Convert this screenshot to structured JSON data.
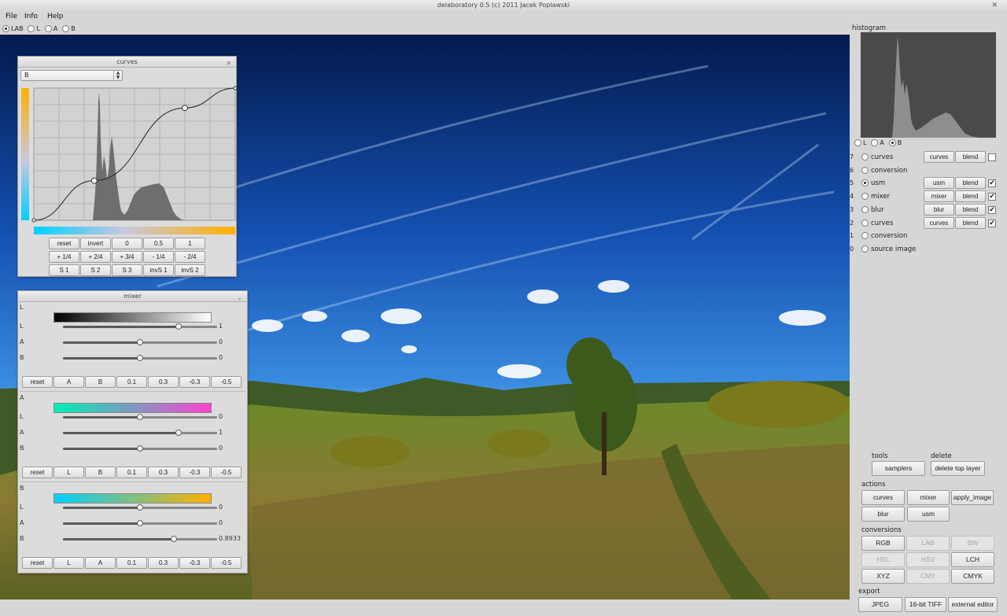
{
  "window": {
    "title": "delaboratory 0.5 (c) 2011 Jacek Poplawski",
    "close": "✕"
  },
  "menu": [
    "File",
    "Info",
    "Help"
  ],
  "modes": {
    "items": [
      "LAB",
      "L",
      "A",
      "B"
    ],
    "selected": 0
  },
  "curves": {
    "title": "curves",
    "close": "✕",
    "channel": "B",
    "curve_points": [
      [
        0,
        0
      ],
      [
        0.3,
        0.3
      ],
      [
        0.75,
        0.85
      ],
      [
        1,
        1
      ]
    ],
    "buttons_row1": [
      "reset",
      "invert",
      "0",
      "0.5",
      "1"
    ],
    "buttons_row2": [
      "+ 1/4",
      "+ 2/4",
      "+ 3/4",
      "- 1/4",
      "- 2/4"
    ],
    "buttons_row3": [
      "S 1",
      "S 2",
      "S 3",
      "invS 1",
      "invS 2"
    ]
  },
  "mixer": {
    "title": "mixer",
    "close": "⌄",
    "sections": [
      {
        "label": "L",
        "gradient": [
          "#000000",
          "#ffffff"
        ],
        "rows": [
          {
            "label": "L",
            "value": "1",
            "pos": 0.75
          },
          {
            "label": "A",
            "value": "0",
            "pos": 0.5
          },
          {
            "label": "B",
            "value": "0",
            "pos": 0.5
          }
        ],
        "buttons": [
          "reset",
          "A",
          "B",
          "0.1",
          "0.3",
          "-0.3",
          "-0.5"
        ]
      },
      {
        "label": "A",
        "gradient": [
          "#00f0b4",
          "#ff40d0"
        ],
        "rows": [
          {
            "label": "L",
            "value": "0",
            "pos": 0.5
          },
          {
            "label": "A",
            "value": "1",
            "pos": 0.75
          },
          {
            "label": "B",
            "value": "0",
            "pos": 0.5
          }
        ],
        "buttons": [
          "reset",
          "L",
          "B",
          "0.1",
          "0.3",
          "-0.3",
          "-0.5"
        ]
      },
      {
        "label": "B",
        "gradient": [
          "#00d0ff",
          "#ffb000"
        ],
        "rows": [
          {
            "label": "L",
            "value": "0",
            "pos": 0.5
          },
          {
            "label": "A",
            "value": "0",
            "pos": 0.5
          },
          {
            "label": "B",
            "value": "0.8933",
            "pos": 0.72
          }
        ],
        "buttons": [
          "reset",
          "L",
          "A",
          "0.1",
          "0.3",
          "-0.3",
          "-0.5"
        ]
      }
    ]
  },
  "histogram": {
    "label": "histogram",
    "channels": [
      "L",
      "A",
      "B"
    ],
    "selected": 2
  },
  "layers": [
    {
      "index": "7",
      "name": "curves",
      "selected": false,
      "buttons": [
        "curves",
        "blend"
      ],
      "checked": false
    },
    {
      "index": "6",
      "name": "conversion",
      "selected": false,
      "buttons": [],
      "checked": null
    },
    {
      "index": "5",
      "name": "usm",
      "selected": true,
      "buttons": [
        "usm",
        "blend"
      ],
      "checked": true
    },
    {
      "index": "4",
      "name": "mixer",
      "selected": false,
      "buttons": [
        "mixer",
        "blend"
      ],
      "checked": true
    },
    {
      "index": "3",
      "name": "blur",
      "selected": false,
      "buttons": [
        "blur",
        "blend"
      ],
      "checked": true
    },
    {
      "index": "2",
      "name": "curves",
      "selected": false,
      "buttons": [
        "curves",
        "blend"
      ],
      "checked": true
    },
    {
      "index": "1",
      "name": "conversion",
      "selected": false,
      "buttons": [],
      "checked": null
    },
    {
      "index": "0",
      "name": "source image",
      "selected": false,
      "buttons": [],
      "checked": null
    }
  ],
  "tools": {
    "label": "tools",
    "button": "samplers"
  },
  "delete": {
    "label": "delete",
    "button": "delete top layer"
  },
  "actions": {
    "label": "actions",
    "buttons": [
      "curves",
      "mixer",
      "apply_image",
      "blur",
      "usm"
    ]
  },
  "conversions": {
    "label": "conversions",
    "buttons": [
      {
        "label": "RGB",
        "enabled": true
      },
      {
        "label": "LAB",
        "enabled": false
      },
      {
        "label": "BW",
        "enabled": false
      },
      {
        "label": "HSL",
        "enabled": false
      },
      {
        "label": "HSV",
        "enabled": false
      },
      {
        "label": "LCH",
        "enabled": true
      },
      {
        "label": "XYZ",
        "enabled": true
      },
      {
        "label": "CMY",
        "enabled": false
      },
      {
        "label": "CMYK",
        "enabled": true
      }
    ]
  },
  "export": {
    "label": "export",
    "buttons": [
      "JPEG",
      "16-bit TIFF",
      "external editor"
    ]
  }
}
